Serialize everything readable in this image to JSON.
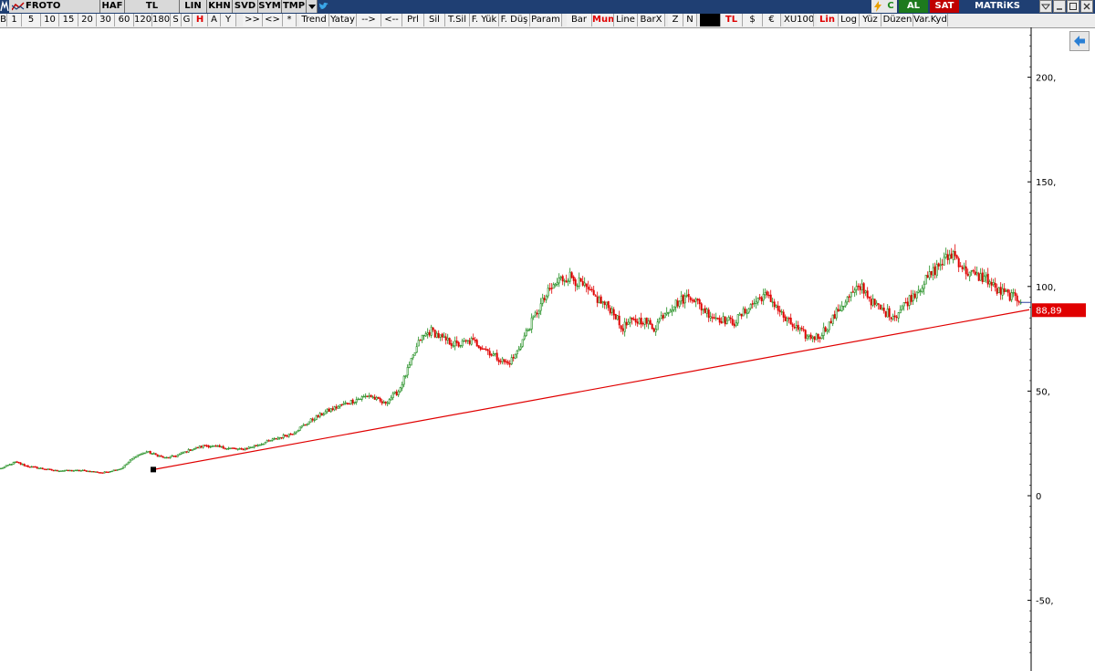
{
  "topbar": {
    "symbol": "FROTO",
    "period": "HAF",
    "currency": "TL",
    "items": [
      "LIN",
      "KHN",
      "SVD",
      "SYM",
      "TMP"
    ],
    "status_c": "C",
    "buy_label": "AL",
    "sell_label": "SAT",
    "brand": "MATRiKS"
  },
  "toolbar": {
    "items": [
      "B",
      "1",
      "5",
      "10",
      "15",
      "20",
      "30",
      "60",
      "120",
      "180",
      "S",
      "G",
      "H",
      "A",
      "Y",
      ">>",
      "<>",
      "*",
      "Trend",
      "Yatay",
      "-->",
      "<--",
      "Prl",
      "Sil",
      "T.Sil",
      "F. Yük",
      "F. Düş",
      "Param",
      "Bar",
      "Mum",
      "Line",
      "BarX",
      "Z",
      "N",
      "",
      "TL",
      "$",
      "€",
      "XU100",
      "Lin",
      "Log",
      "Yüz",
      "Düzen",
      "Var.Kyd"
    ]
  },
  "colors": {
    "up": "#1a8a1a",
    "down": "#e00000",
    "trend": "#e00000",
    "price_tag": "#e00000"
  },
  "chart_data": {
    "type": "candlestick",
    "frequency": "weekly",
    "ylim": [
      -80,
      222
    ],
    "yticks": [
      200,
      150,
      100,
      50,
      0,
      -50
    ],
    "ytick_labels": [
      "200,",
      "150,",
      "100,",
      "50,",
      "0",
      "-50,"
    ],
    "last_price_label": "88,89",
    "trendline": {
      "from_week": 84,
      "from_value": 12.5,
      "to_week": 503,
      "to_value": 88.89
    },
    "anchors": [
      [
        0,
        13
      ],
      [
        8,
        16
      ],
      [
        15,
        14
      ],
      [
        30,
        12
      ],
      [
        45,
        12
      ],
      [
        56,
        11
      ],
      [
        66,
        13
      ],
      [
        74,
        19
      ],
      [
        80,
        21
      ],
      [
        90,
        18
      ],
      [
        96,
        19
      ],
      [
        104,
        22
      ],
      [
        112,
        24
      ],
      [
        122,
        23
      ],
      [
        132,
        22
      ],
      [
        140,
        24
      ],
      [
        150,
        27
      ],
      [
        160,
        30
      ],
      [
        170,
        36
      ],
      [
        178,
        40
      ],
      [
        186,
        43
      ],
      [
        195,
        46
      ],
      [
        202,
        48
      ],
      [
        210,
        44
      ],
      [
        218,
        50
      ],
      [
        224,
        62
      ],
      [
        230,
        75
      ],
      [
        236,
        79
      ],
      [
        242,
        75
      ],
      [
        250,
        72
      ],
      [
        258,
        74
      ],
      [
        266,
        70
      ],
      [
        272,
        66
      ],
      [
        278,
        63
      ],
      [
        282,
        67
      ],
      [
        288,
        78
      ],
      [
        294,
        88
      ],
      [
        300,
        97
      ],
      [
        306,
        103
      ],
      [
        312,
        105
      ],
      [
        318,
        101
      ],
      [
        324,
        96
      ],
      [
        330,
        92
      ],
      [
        336,
        88
      ],
      [
        340,
        80
      ],
      [
        345,
        83
      ],
      [
        352,
        84
      ],
      [
        358,
        80
      ],
      [
        364,
        88
      ],
      [
        370,
        92
      ],
      [
        378,
        96
      ],
      [
        384,
        90
      ],
      [
        390,
        86
      ],
      [
        396,
        84
      ],
      [
        402,
        83
      ],
      [
        410,
        90
      ],
      [
        418,
        96
      ],
      [
        424,
        92
      ],
      [
        430,
        84
      ],
      [
        436,
        80
      ],
      [
        442,
        76
      ],
      [
        448,
        76
      ],
      [
        454,
        82
      ],
      [
        460,
        90
      ],
      [
        466,
        96
      ],
      [
        472,
        100
      ],
      [
        478,
        92
      ],
      [
        484,
        88
      ],
      [
        490,
        86
      ],
      [
        496,
        92
      ],
      [
        502,
        98
      ],
      [
        508,
        104
      ],
      [
        514,
        110
      ],
      [
        522,
        116
      ],
      [
        528,
        108
      ],
      [
        534,
        105
      ],
      [
        540,
        104
      ],
      [
        546,
        98
      ],
      [
        552,
        96
      ],
      [
        557,
        94
      ]
    ],
    "n_weeks": 560
  }
}
